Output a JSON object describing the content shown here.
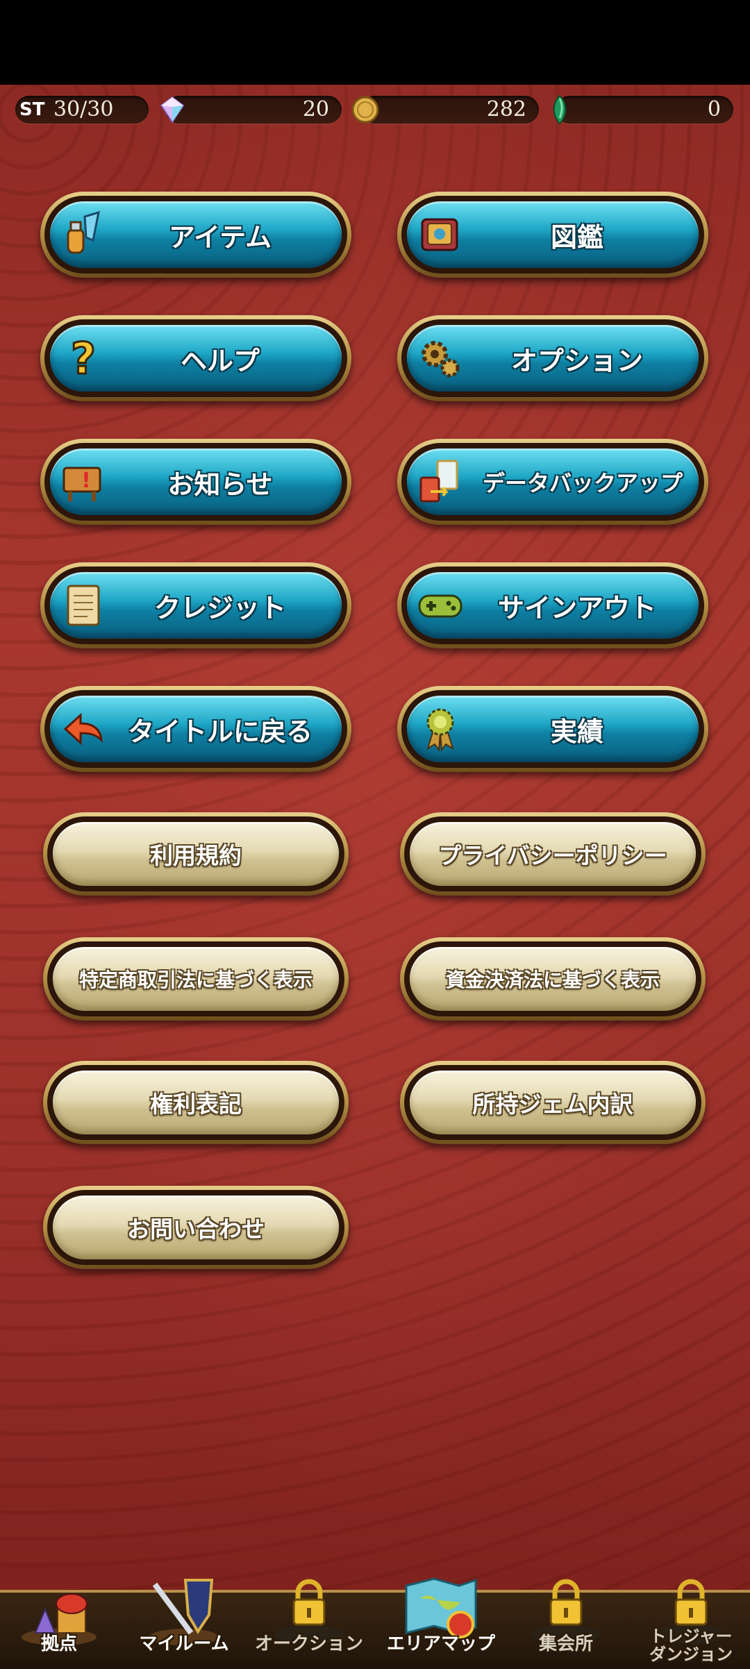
{
  "status": {
    "st_label": "ST",
    "stamina": "30/30",
    "gems": "20",
    "coins": "282",
    "emeralds": "0"
  },
  "menu": {
    "item": "アイテム",
    "encyclopedia": "図鑑",
    "help": "ヘルプ",
    "option": "オプション",
    "news": "お知らせ",
    "data_backup": "データバックアップ",
    "credit": "クレジット",
    "sign_out": "サインアウト",
    "back_to_title": "タイトルに戻る",
    "achievements": "実績",
    "terms": "利用規約",
    "privacy": "プライバシーポリシー",
    "commercial_law": "特定商取引法に基づく表示",
    "funds_law": "資金決済法に基づく表示",
    "rights": "権利表記",
    "gem_breakdown": "所持ジェム内訳",
    "contact": "お問い合わせ"
  },
  "nav": {
    "base": "拠点",
    "my_room": "マイルーム",
    "auction": "オークション",
    "area_map": "エリアマップ",
    "gathering": "集会所",
    "treasure_line1": "トレジャー",
    "treasure_line2": "ダンジョン"
  },
  "colors": {
    "background": "#9a302a",
    "button_blue": "#1fa7c6",
    "button_cream": "#e4d9b2",
    "gold_frame": "#b89448"
  }
}
